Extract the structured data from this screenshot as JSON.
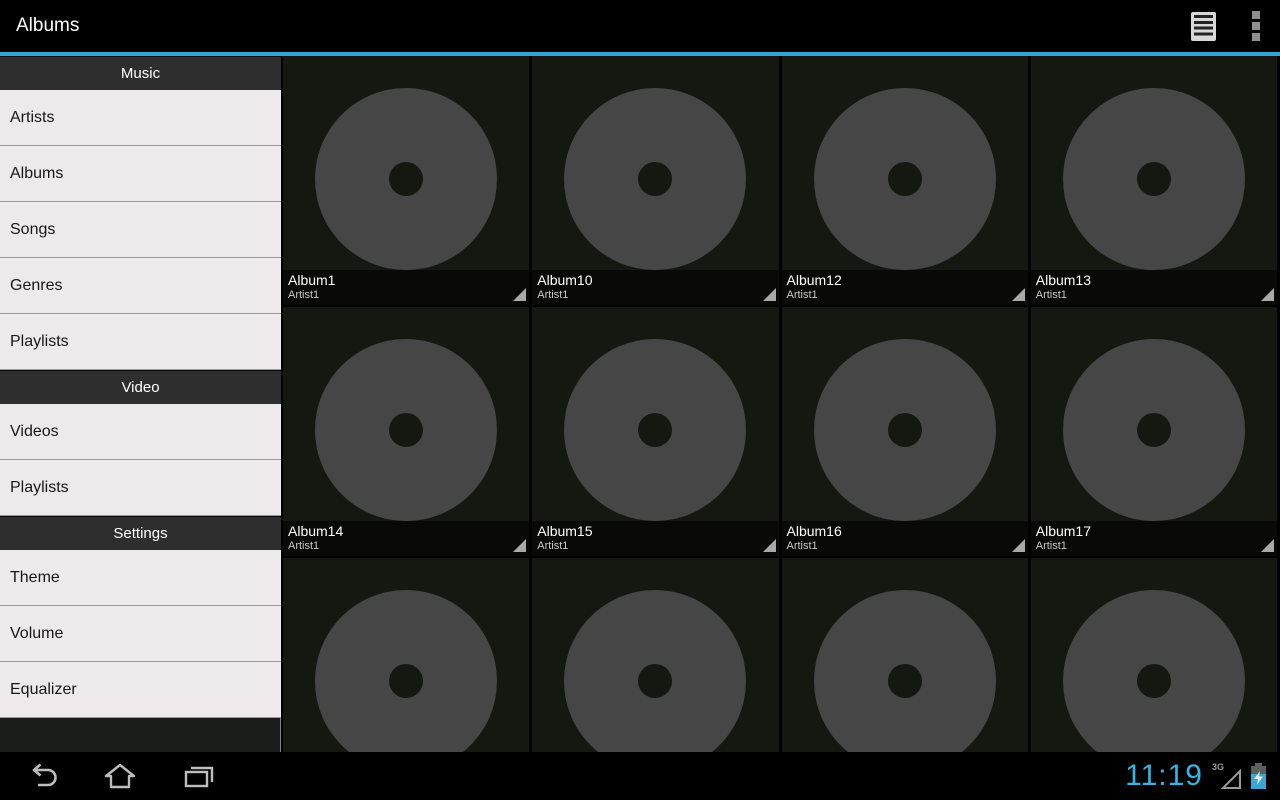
{
  "action_bar": {
    "title": "Albums"
  },
  "sidebar": {
    "sections": [
      {
        "header": "Music",
        "items": [
          "Artists",
          "Albums",
          "Songs",
          "Genres",
          "Playlists"
        ]
      },
      {
        "header": "Video",
        "items": [
          "Videos",
          "Playlists"
        ]
      },
      {
        "header": "Settings",
        "items": [
          "Theme",
          "Volume",
          "Equalizer"
        ]
      }
    ]
  },
  "albums": [
    {
      "title": "Album1",
      "artist": "Artist1"
    },
    {
      "title": "Album10",
      "artist": "Artist1"
    },
    {
      "title": "Album12",
      "artist": "Artist1"
    },
    {
      "title": "Album13",
      "artist": "Artist1"
    },
    {
      "title": "Album14",
      "artist": "Artist1"
    },
    {
      "title": "Album15",
      "artist": "Artist1"
    },
    {
      "title": "Album16",
      "artist": "Artist1"
    },
    {
      "title": "Album17",
      "artist": "Artist1"
    }
  ],
  "partial_row_tiles": 4,
  "status_bar": {
    "clock": "11:19",
    "network": "3G",
    "battery_state": "charging"
  },
  "colors": {
    "accent_line": "#2EA5D6",
    "clock_blue": "#33B5E5",
    "action_bar_bg": "#000000",
    "sidebar_header_bg": "#2E2E2E",
    "sidebar_item_bg": "#EEE9EA",
    "tile_bg": "#141811",
    "disc_gray": "#464646",
    "battery_fill": "#3BA6CF"
  }
}
